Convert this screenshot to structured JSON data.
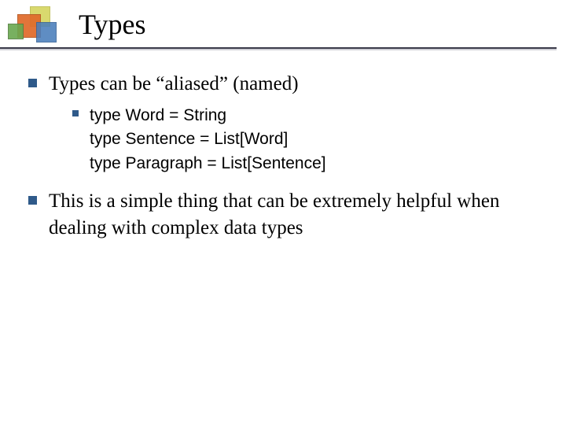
{
  "title": "Types",
  "bullets": {
    "first": "Types can be “aliased” (named)",
    "code": "type Word = String\ntype Sentence = List[Word]\ntype Paragraph = List[Sentence]",
    "second": "This is a simple thing that can be extremely helpful when dealing with complex data types"
  }
}
